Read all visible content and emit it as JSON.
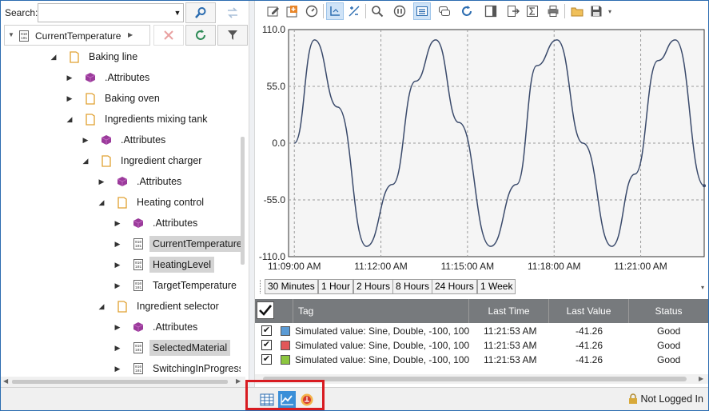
{
  "search": {
    "label": "Search:",
    "value": "",
    "placeholder": ""
  },
  "path": {
    "current": "CurrentTemperature"
  },
  "tree": [
    {
      "label": "Baking line",
      "depth": 0,
      "expand": "down",
      "icon": "folder-icon",
      "selected": false
    },
    {
      "label": ".Attributes",
      "depth": 1,
      "expand": "right",
      "icon": "cube-icon",
      "selected": false
    },
    {
      "label": "Baking oven",
      "depth": 1,
      "expand": "right",
      "icon": "folder-icon",
      "selected": false
    },
    {
      "label": "Ingredients mixing tank",
      "depth": 1,
      "expand": "down",
      "icon": "folder-icon",
      "selected": false
    },
    {
      "label": ".Attributes",
      "depth": 2,
      "expand": "right",
      "icon": "cube-icon",
      "selected": false
    },
    {
      "label": "Ingredient charger",
      "depth": 2,
      "expand": "down",
      "icon": "folder-icon",
      "selected": false
    },
    {
      "label": ".Attributes",
      "depth": 3,
      "expand": "right",
      "icon": "cube-icon",
      "selected": false
    },
    {
      "label": "Heating control",
      "depth": 3,
      "expand": "down",
      "icon": "folder-icon",
      "selected": false
    },
    {
      "label": ".Attributes",
      "depth": 4,
      "expand": "right",
      "icon": "cube-icon",
      "selected": false
    },
    {
      "label": "CurrentTemperature",
      "depth": 4,
      "expand": "right",
      "icon": "tag-icon",
      "selected": true
    },
    {
      "label": "HeatingLevel",
      "depth": 4,
      "expand": "right",
      "icon": "tag-icon",
      "selected": true
    },
    {
      "label": "TargetTemperature",
      "depth": 4,
      "expand": "right",
      "icon": "tag-icon",
      "selected": false
    },
    {
      "label": "Ingredient selector",
      "depth": 3,
      "expand": "down",
      "icon": "folder-icon",
      "selected": false
    },
    {
      "label": ".Attributes",
      "depth": 4,
      "expand": "right",
      "icon": "cube-icon",
      "selected": false
    },
    {
      "label": "SelectedMaterial",
      "depth": 4,
      "expand": "right",
      "icon": "tag-icon",
      "selected": true
    },
    {
      "label": "SwitchingInProgress",
      "depth": 4,
      "expand": "right",
      "icon": "tag-icon",
      "selected": false
    }
  ],
  "chart_data": {
    "type": "line",
    "title": "",
    "xlabel": "",
    "ylabel": "",
    "ylim": [
      -110,
      110
    ],
    "yticks": [
      "110.0",
      "55.0",
      "0.0",
      "-55.0",
      "-110.0"
    ],
    "xticks": [
      "11:09:00 AM",
      "11:12:00 AM",
      "11:15:00 AM",
      "11:18:00 AM",
      "11:21:00 AM"
    ],
    "grid": true,
    "series": [
      {
        "color": "#3a4a6b",
        "x_minutes_from_1109": [
          0.2,
          0.9,
          1.7,
          2.7,
          3.6,
          4.4,
          5.1,
          5.9,
          7.0,
          7.9,
          8.6,
          9.3,
          10.2,
          11.2,
          12.0,
          12.8,
          13.4,
          14.4
        ],
        "values": [
          0,
          100,
          35,
          -100,
          -40,
          60,
          100,
          20,
          -100,
          -40,
          75,
          100,
          0,
          -100,
          -30,
          80,
          100,
          -41.26
        ]
      }
    ]
  },
  "ranges": [
    "30 Minutes",
    "1 Hour",
    "2 Hours",
    "8 Hours",
    "24 Hours",
    "1 Week"
  ],
  "grid": {
    "headers": {
      "tag": "Tag",
      "last_time": "Last Time",
      "last_value": "Last Value",
      "status": "Status"
    },
    "rows": [
      {
        "checked": true,
        "color": "#5b9bd5",
        "tag": "Simulated value: Sine, Double, -100, 100",
        "time": "11:21:53 AM",
        "value": "-41.26",
        "status": "Good"
      },
      {
        "checked": true,
        "color": "#e15759",
        "tag": "Simulated value: Sine, Double, -100, 100",
        "time": "11:21:53 AM",
        "value": "-41.26",
        "status": "Good"
      },
      {
        "checked": true,
        "color": "#8cc63f",
        "tag": "Simulated value: Sine, Double, -100, 100",
        "time": "11:21:53 AM",
        "value": "-41.26",
        "status": "Good"
      }
    ]
  },
  "status": {
    "login": "Not Logged In"
  },
  "colors": {
    "accent": "#3a8fd8",
    "highlight": "#d81b21",
    "header": "#777a7d"
  }
}
